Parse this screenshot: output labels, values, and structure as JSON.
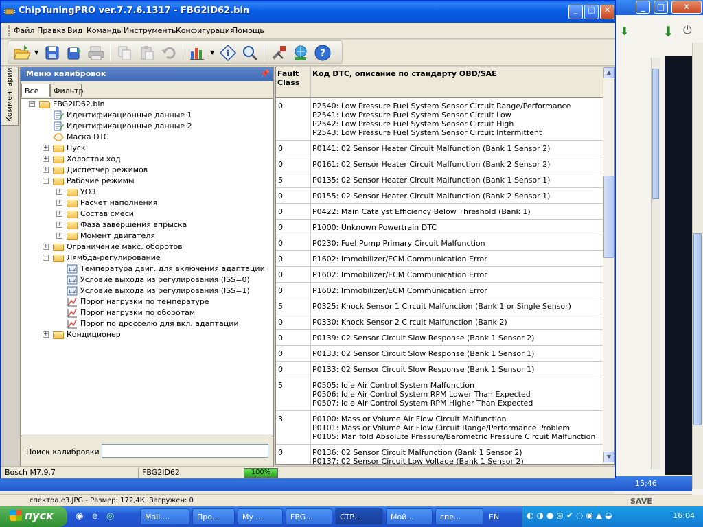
{
  "window": {
    "title": "ChipTuningPRO ver.7.7.6.1317 - FBG2ID62.bin"
  },
  "menu": [
    "Файл",
    "Правка",
    "Вид",
    "Команды",
    "Инструменты",
    "Конфигурация",
    "Помощь"
  ],
  "side_tab": "Комментарии",
  "panel": {
    "title": "Меню калибровок",
    "tabs": [
      "Все",
      "Фильтр"
    ],
    "search_label": "Поиск калибровки",
    "search_value": ""
  },
  "tree": [
    {
      "label": "FBG2ID62.bin",
      "level": 0,
      "icon": "folder-icon",
      "expander": "-"
    },
    {
      "label": "Идентификационные данные 1",
      "level": 1,
      "icon": "edit-doc-icon",
      "expander": ""
    },
    {
      "label": "Идентификационные данные 2",
      "level": 1,
      "icon": "edit-doc-icon",
      "expander": ""
    },
    {
      "label": "Маска DTC",
      "level": 1,
      "icon": "mask-icon",
      "expander": ""
    },
    {
      "label": "Пуск",
      "level": 1,
      "icon": "folder-icon",
      "expander": "+"
    },
    {
      "label": "Холостой ход",
      "level": 1,
      "icon": "folder-icon",
      "expander": "+"
    },
    {
      "label": "Диспетчер режимов",
      "level": 1,
      "icon": "folder-icon",
      "expander": "+"
    },
    {
      "label": "Рабочие режимы",
      "level": 1,
      "icon": "folder-icon",
      "expander": "-"
    },
    {
      "label": "УОЗ",
      "level": 2,
      "icon": "folder-icon",
      "expander": "+"
    },
    {
      "label": "Расчет наполнения",
      "level": 2,
      "icon": "folder-icon",
      "expander": "+"
    },
    {
      "label": "Состав смеси",
      "level": 2,
      "icon": "folder-icon",
      "expander": "+"
    },
    {
      "label": "Фаза завершения впрыска",
      "level": 2,
      "icon": "folder-icon",
      "expander": "+"
    },
    {
      "label": "Момент двигателя",
      "level": 2,
      "icon": "folder-icon",
      "expander": "+"
    },
    {
      "label": "Ограничение макс. оборотов",
      "level": 1,
      "icon": "folder-icon",
      "expander": "+"
    },
    {
      "label": "Лямбда-регулирование",
      "level": 1,
      "icon": "folder-icon",
      "expander": "-"
    },
    {
      "label": "Температура двиг. для включения адаптации",
      "level": 2,
      "icon": "scalar-icon",
      "expander": ""
    },
    {
      "label": "Условие выхода из регулирования (ISS=0)",
      "level": 2,
      "icon": "scalar-icon",
      "expander": ""
    },
    {
      "label": "Условие выхода из регулирования (ISS=1)",
      "level": 2,
      "icon": "scalar-icon",
      "expander": ""
    },
    {
      "label": "Порог нагрузки по температуре",
      "level": 2,
      "icon": "curve-icon",
      "expander": ""
    },
    {
      "label": "Порог нагрузки по оборотам",
      "level": 2,
      "icon": "curve-icon",
      "expander": ""
    },
    {
      "label": "Порог по дросселю для вкл. адаптации",
      "level": 2,
      "icon": "curve-icon",
      "expander": ""
    },
    {
      "label": "Кондиционер",
      "level": 1,
      "icon": "folder-icon",
      "expander": "+"
    }
  ],
  "grid": {
    "headers": [
      "Fault\nClass",
      "Код DTC, описание по стандарту OBD/SAE"
    ],
    "rows": [
      {
        "class": "0",
        "text": "P2540: Low Pressure Fuel System Sensor Circuit Range/Performance\nP2541: Low Pressure Fuel System Sensor Circuit Low\nP2542: Low Pressure Fuel System Sensor Circuit High\nP2543: Low Pressure Fuel System Sensor Circuit Intermittent"
      },
      {
        "class": "0",
        "text": "P0141: 02 Sensor Heater Circuit Malfunction (Bank 1 Sensor 2)"
      },
      {
        "class": "0",
        "text": "P0161: 02 Sensor Heater Circuit Malfunction (Bank 2 Sensor 2)"
      },
      {
        "class": "5",
        "text": "P0135: 02 Sensor Heater Circuit Malfunction (Bank 1 Sensor 1)"
      },
      {
        "class": "0",
        "text": "P0155: 02 Sensor Heater Circuit Malfunction (Bank 2 Sensor 1)"
      },
      {
        "class": "0",
        "text": "P0422: Main Catalyst Efficiency Below Threshold (Bank 1)"
      },
      {
        "class": "0",
        "text": "P1000: Unknown Powertrain DTC"
      },
      {
        "class": "0",
        "text": "P0230: Fuel Pump Primary Circuit Malfunction"
      },
      {
        "class": "0",
        "text": "P1602: Immobilizer/ECM Communication Error"
      },
      {
        "class": "0",
        "text": "P1602: Immobilizer/ECM Communication Error"
      },
      {
        "class": "0",
        "text": "P1602: Immobilizer/ECM Communication Error"
      },
      {
        "class": "5",
        "text": "P0325: Knock Sensor 1 Circuit Malfunction (Bank 1 or Single Sensor)"
      },
      {
        "class": "0",
        "text": "P0330: Knock Sensor 2 Circuit Malfunction (Bank 2)"
      },
      {
        "class": "0",
        "text": "P0139: 02 Sensor Circuit Slow Response (Bank 1 Sensor 2)"
      },
      {
        "class": "0",
        "text": "P0133: 02 Sensor Circuit Slow Response (Bank 1 Sensor 1)"
      },
      {
        "class": "0",
        "text": "P0133: 02 Sensor Circuit Slow Response (Bank 1 Sensor 1)"
      },
      {
        "class": "5",
        "text": "P0505: Idle Air Control System Malfunction\nP0506: Idle Air Control System RPM Lower Than Expected\nP0507: Idle Air Control System RPM Higher Than Expected"
      },
      {
        "class": "3",
        "text": "P0100: Mass or Volume Air Flow Circuit Malfunction\nP0101: Mass or Volume Air Flow Circuit Range/Performance Problem\nP0105: Manifold Absolute Pressure/Barometric Pressure Circuit Malfunction"
      },
      {
        "class": "0",
        "text": "P0136: 02 Sensor Circuit Malfunction (Bank 1 Sensor 2)\nP0137: 02 Sensor Circuit Low Voltage (Bank 1 Sensor 2)"
      }
    ]
  },
  "status": {
    "ecu": "Bosch M7.9.7",
    "file": "FBG2ID62",
    "progress_label": "100%",
    "progress_value": 100
  },
  "background": {
    "status_text": "спектра e3.JPG - Размер: 172,4К, Загружен: 0",
    "save_label": "SAVE",
    "inner_clock": "15:46"
  },
  "taskbar": {
    "start": "пуск",
    "tasks": [
      "Mail....",
      "Про...",
      "My ...",
      "FBG...",
      "СТР...",
      "Мой...",
      "спе..."
    ],
    "lang": "EN",
    "clock": "16:04"
  },
  "colors": {
    "title_blue": "#0b5fe4",
    "panel_header": "#3d68b5",
    "progress_green": "#2aa61d"
  }
}
